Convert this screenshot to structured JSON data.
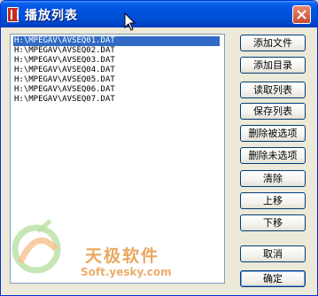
{
  "window": {
    "title": "播放列表"
  },
  "playlist": {
    "items": [
      "H:\\MPEGAV\\AVSEQ01.DAT",
      "H:\\MPEGAV\\AVSEQ02.DAT",
      "H:\\MPEGAV\\AVSEQ03.DAT",
      "H:\\MPEGAV\\AVSEQ04.DAT",
      "H:\\MPEGAV\\AVSEQ05.DAT",
      "H:\\MPEGAV\\AVSEQ06.DAT",
      "H:\\MPEGAV\\AVSEQ07.DAT"
    ],
    "selected_index": 0
  },
  "buttons": {
    "add_file": "添加文件",
    "add_dir": "添加目录",
    "load_list": "读取列表",
    "save_list": "保存列表",
    "remove_selected": "删除被选项",
    "remove_unselected": "删除未选项",
    "clear": "清除",
    "move_up": "上移",
    "move_down": "下移",
    "cancel": "取消",
    "ok": "确定"
  },
  "watermark": {
    "name": "天极软件",
    "site": "Soft.yesky.com"
  },
  "colors": {
    "title_bar": "#0054e3",
    "selection": "#316ac5",
    "dialog_bg": "#ece9d8"
  }
}
